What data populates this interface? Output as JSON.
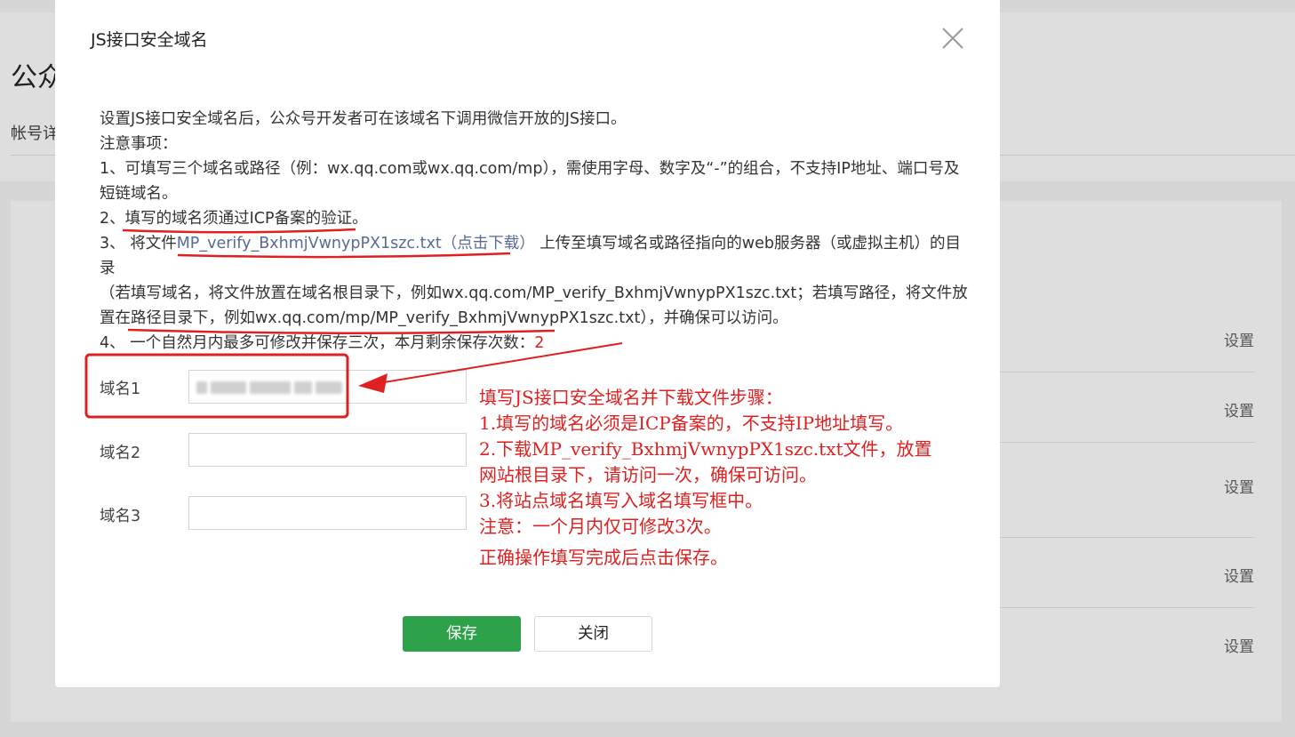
{
  "background": {
    "page_title": "公众",
    "subtab": "帐号详",
    "set_links": [
      "设置",
      "设置",
      "设置",
      "设置",
      "设置"
    ]
  },
  "dialog": {
    "title": "JS接口安全域名",
    "close_icon": "close-icon",
    "intro": "设置JS接口安全域名后，公众号开发者可在该域名下调用微信开放的JS接口。",
    "notes_heading": "注意事项：",
    "note1": "1、可填写三个域名或路径（例：wx.qq.com或wx.qq.com/mp），需使用字母、数字及“-”的组合，不支持IP地址、端口号及",
    "note1_cont": "短链域名。",
    "note2": "2、填写的域名须通过ICP备案的验证。",
    "note3_prefix": "3、 将文件",
    "note3_link": "MP_verify_BxhmjVwnypPX1szc.txt（点击下载）",
    "note3_suffix": "上传至填写域名或路径指向的web服务器（或虚拟主机）的目录",
    "note3_line2": "（若填写域名，将文件放置在域名根目录下，例如wx.qq.com/MP_verify_BxhmjVwnypPX1szc.txt；若填写路径，将文件放",
    "note3_line3": "置在路径目录下，例如wx.qq.com/mp/MP_verify_BxhmjVwnypPX1szc.txt），并确保可以访问。",
    "note4_prefix": "4、 一个自然月内最多可修改并保存三次，本月剩余保存次数：",
    "note4_count": "2",
    "fields": [
      {
        "label": "域名1",
        "value": ""
      },
      {
        "label": "域名2",
        "value": ""
      },
      {
        "label": "域名3",
        "value": ""
      }
    ],
    "save_label": "保存",
    "close_label": "关闭"
  },
  "annotation": {
    "lines": [
      "填写JS接口安全域名并下载文件步骤：",
      "1.填写的域名必须是ICP备案的，不支持IP地址填写。",
      "2.下载MP_verify_BxhmjVwnypPX1szc.txt文件，放置",
      "网站根目录下，请访问一次，确保可访问。",
      "3.将站点域名填写入域名填写框中。",
      "注意：一个月内仅可修改3次。",
      "正确操作填写完成后点击保存。"
    ],
    "color": "#e02020"
  },
  "colors": {
    "primary_button": "#2ea24a",
    "link": "#576b95",
    "annotation": "#e02020"
  }
}
